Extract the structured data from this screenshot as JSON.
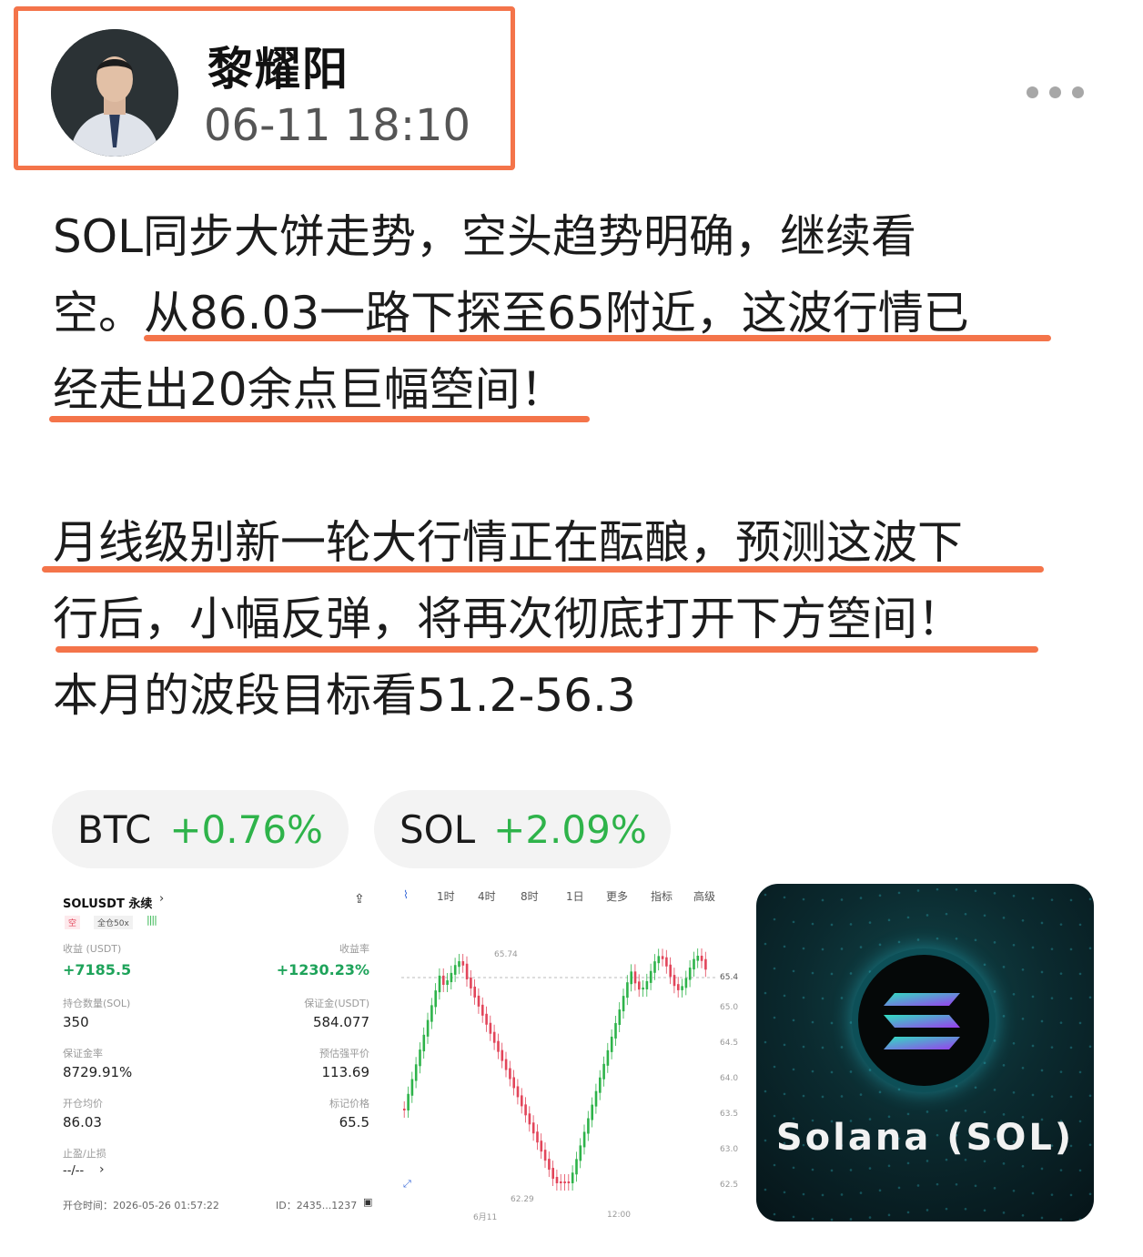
{
  "author": {
    "name": "黎耀阳",
    "time": "06-11 18:10"
  },
  "post": {
    "lines": [
      "SOL同步大饼走势，空头趋势明确，继续看",
      "空。从86.03一路下探至65附近，这波行情已",
      "经走出20余点巨幅箜间！",
      "",
      "月线级别新一轮大行情正在酝酿，预测这波下",
      "行后，小幅反弹，将再次彻底打开下方箜间！",
      "本月的波段目标看51.2-56.3"
    ]
  },
  "tags": [
    {
      "symbol": "BTC",
      "change": "+0.76%"
    },
    {
      "symbol": "SOL",
      "change": "+2.09%"
    }
  ],
  "position_card": {
    "pair": "SOLUSDT 永续",
    "side": "空",
    "leverage": "全仓50x",
    "pnl_label": "收益 (USDT)",
    "pnl": "+7185.5",
    "roe_label": "收益率",
    "roe": "+1230.23%",
    "qty_label": "持仓数量(SOL)",
    "qty": "350",
    "margin_label": "保证金(USDT)",
    "margin": "584.077",
    "margin_ratio_label": "保证金率",
    "margin_ratio": "8729.91%",
    "liq_label": "预估强平价",
    "liq": "113.69",
    "entry_label": "开仓均价",
    "entry": "86.03",
    "mark_label": "标记价格",
    "mark": "65.5",
    "tpsl_label": "止盈/止损",
    "tpsl": "--/--",
    "open_time": "开仓时间：2026-05-26 01:57:22",
    "id": "ID：2435...1237"
  },
  "kline": {
    "tabs": [
      "1时",
      "4时",
      "8时",
      "1日",
      "更多",
      "指标",
      "高级"
    ],
    "high_label": "65.74",
    "low_label": "62.29",
    "price_tag": "65.4",
    "y_ticks": [
      "65.0",
      "64.5",
      "64.0",
      "63.5",
      "63.0",
      "62.5"
    ],
    "x_ticks": [
      "6月11",
      "12:00"
    ]
  },
  "promo": {
    "title": "Solana (SOL)"
  },
  "colors": {
    "accent": "#f4744a",
    "up": "#2eb34a",
    "down": "#e2455a"
  }
}
